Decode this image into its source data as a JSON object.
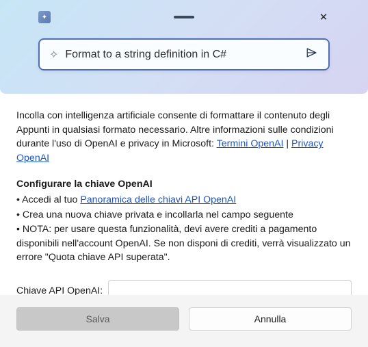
{
  "banner": {
    "prompt_example": "Format to a string definition in C#"
  },
  "intro": {
    "text_pre": "Incolla con intelligenza artificiale consente di formattare il contenuto degli Appunti in qualsiasi formato necessario. Altre informazioni sulle condizioni durante l'uso di OpenAI e privacy in Microsoft: ",
    "link1": "Termini OpenAI",
    "separator": " | ",
    "link2": "Privacy OpenAI"
  },
  "config": {
    "heading": "Configurare la chiave OpenAI",
    "bullet1_pre": "• Accedi al tuo ",
    "bullet1_link": "Panoramica delle chiavi API OpenAI",
    "bullet2": "• Crea una nuova chiave privata e incollarla nel campo seguente",
    "bullet3": "• NOTA: per usare questa funzionalità, devi avere crediti a pagamento disponibili nell'account OpenAI. Se non disponi di crediti, verrà visualizzato un errore \"Quota chiave API superata\"."
  },
  "field": {
    "label": "Chiave API OpenAI:",
    "value": ""
  },
  "buttons": {
    "save": "Salva",
    "cancel": "Annulla"
  }
}
